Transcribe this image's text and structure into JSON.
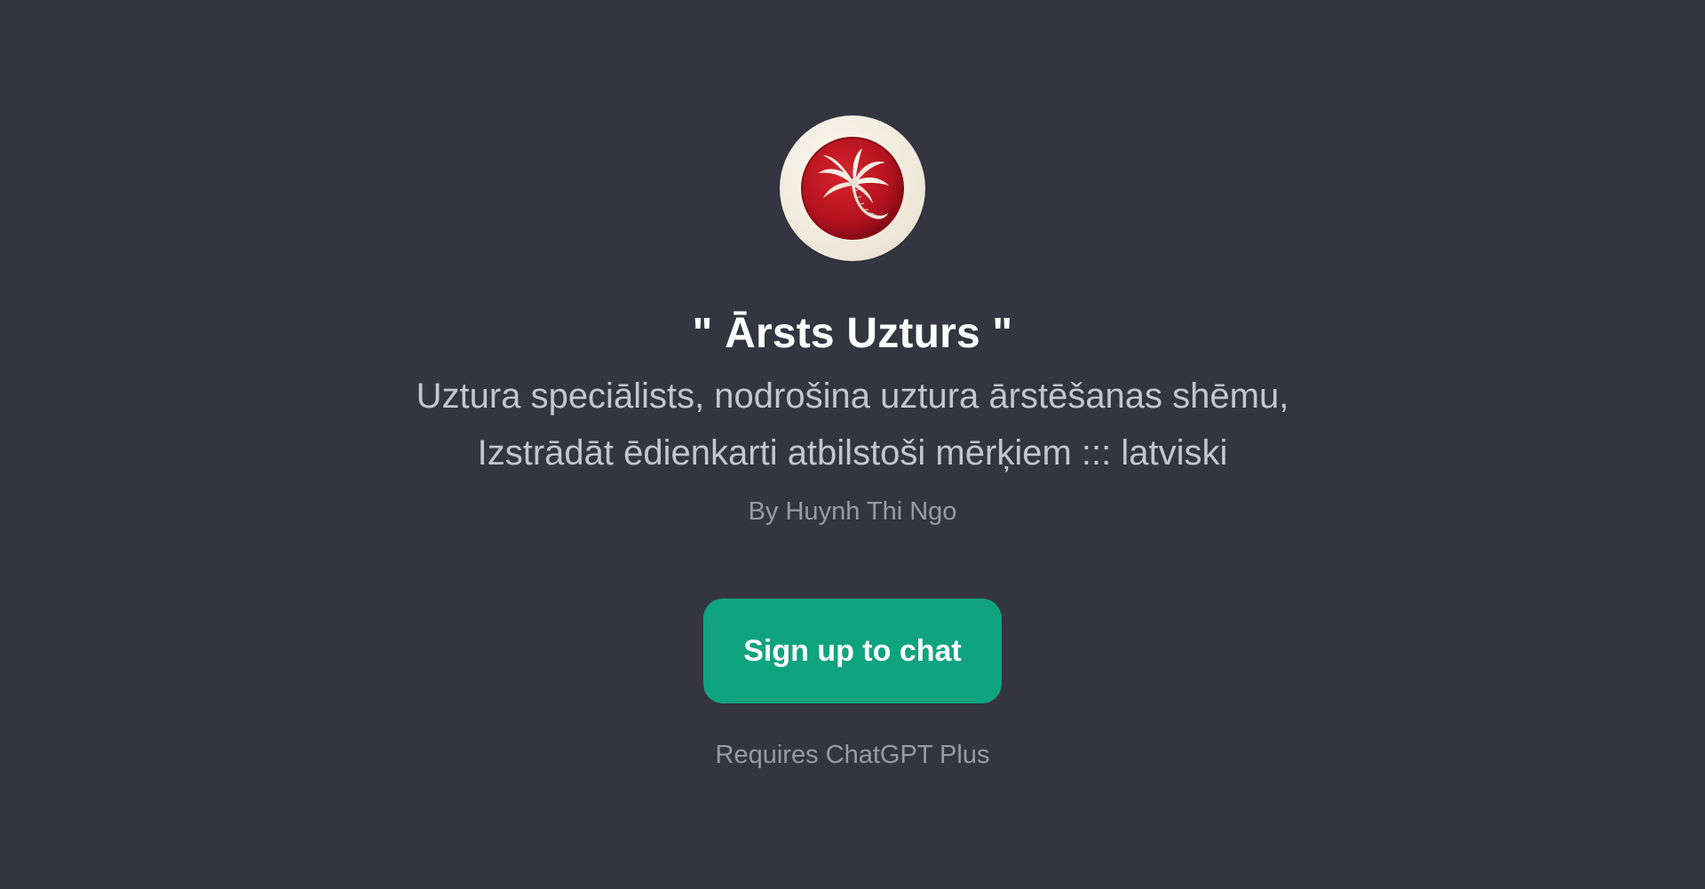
{
  "gpt": {
    "title": "\" Ārsts Uzturs \"",
    "description": "Uztura speciālists, nodrošina uztura ārstēšanas shēmu, Izstrādāt ēdienkarti atbilstoši mērķiem ::: latviski",
    "author": "By Huynh Thi Ngo",
    "avatar_icon": "palm-tree-icon"
  },
  "actions": {
    "signup_label": "Sign up to chat",
    "requirement": "Requires ChatGPT Plus"
  },
  "colors": {
    "background": "#343541",
    "accent": "#10a37f",
    "title": "#ffffff",
    "description": "#c5c5d2",
    "muted": "#9a9aa6",
    "avatar_badge": "#b3121f"
  }
}
